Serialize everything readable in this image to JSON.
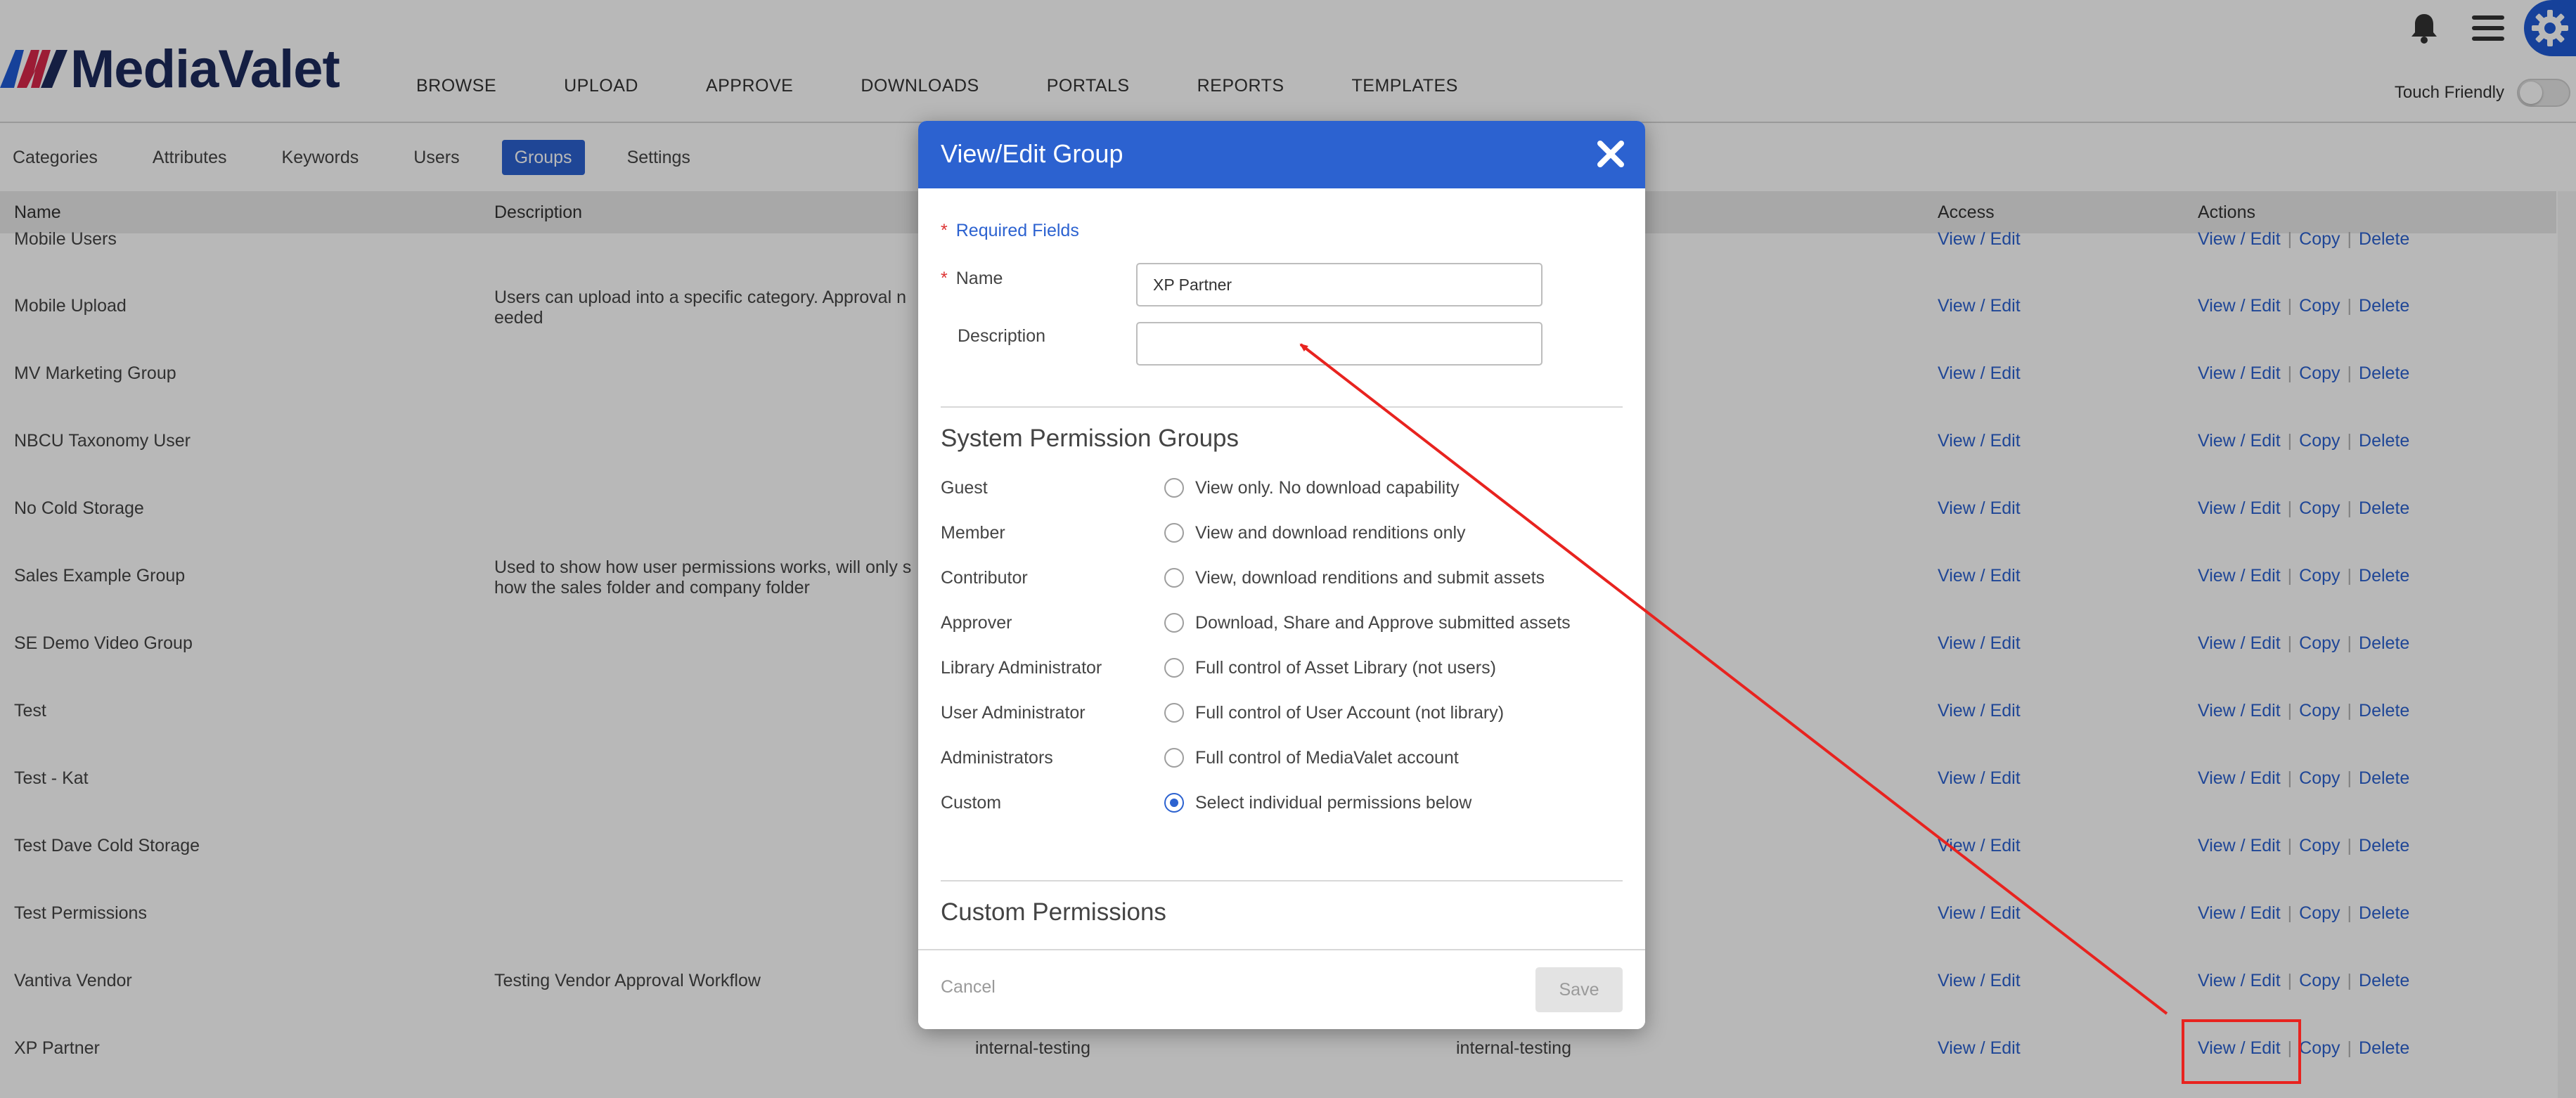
{
  "header": {
    "brand": "MediaValet",
    "nav": [
      "BROWSE",
      "UPLOAD",
      "APPROVE",
      "DOWNLOADS",
      "PORTALS",
      "REPORTS",
      "TEMPLATES"
    ],
    "touch_label": "Touch Friendly",
    "touch_enabled": false,
    "accent_color": "#1f5bd6"
  },
  "subtabs": {
    "items": [
      "Categories",
      "Attributes",
      "Keywords",
      "Users",
      "Groups",
      "Settings"
    ],
    "active": "Groups"
  },
  "table": {
    "headers": {
      "name": "Name",
      "description": "Description",
      "access": "Access",
      "actions": "Actions"
    },
    "action_labels": {
      "view_edit": "View / Edit",
      "copy": "Copy",
      "delete": "Delete"
    },
    "rows": [
      {
        "name": "Mobile Users",
        "description": "",
        "col3": "",
        "col4": ""
      },
      {
        "name": "Mobile Upload",
        "description": "Users can upload into a specific category. Approval n\needed",
        "col3": "",
        "col4": ""
      },
      {
        "name": "MV Marketing Group",
        "description": "",
        "col3": "",
        "col4": ""
      },
      {
        "name": "NBCU Taxonomy User",
        "description": "",
        "col3": "",
        "col4": ""
      },
      {
        "name": "No Cold Storage",
        "description": "",
        "col3": "",
        "col4": ""
      },
      {
        "name": "Sales Example Group",
        "description": "Used to show how user permissions works, will only s\nhow the sales folder and company folder",
        "col3": "",
        "col4": ""
      },
      {
        "name": "SE Demo Video Group",
        "description": "",
        "col3": "",
        "col4": ""
      },
      {
        "name": "Test",
        "description": "",
        "col3": "",
        "col4": ""
      },
      {
        "name": "Test - Kat",
        "description": "",
        "col3": "",
        "col4": ""
      },
      {
        "name": "Test Dave Cold Storage",
        "description": "",
        "col3": "",
        "col4": ""
      },
      {
        "name": "Test Permissions",
        "description": "",
        "col3": "",
        "col4": ""
      },
      {
        "name": "Vantiva Vendor",
        "description": "Testing Vendor Approval Workflow",
        "col3": "",
        "col4": ""
      },
      {
        "name": "XP Partner",
        "description": "",
        "col3": "internal-testing",
        "col4": "internal-testing"
      }
    ]
  },
  "modal": {
    "title": "View/Edit Group",
    "required_note": "Required Fields",
    "name_label": "Name",
    "name_value": "XP Partner",
    "description_label": "Description",
    "description_value": "",
    "system_section_title": "System Permission Groups",
    "permissions": [
      {
        "label": "Guest",
        "description": "View only. No download capability",
        "checked": false
      },
      {
        "label": "Member",
        "description": "View and download renditions only",
        "checked": false
      },
      {
        "label": "Contributor",
        "description": "View, download renditions and submit assets",
        "checked": false
      },
      {
        "label": "Approver",
        "description": "Download, Share and Approve submitted assets",
        "checked": false
      },
      {
        "label": "Library Administrator",
        "description": "Full control of Asset Library (not users)",
        "checked": false
      },
      {
        "label": "User Administrator",
        "description": "Full control of User Account (not library)",
        "checked": false
      },
      {
        "label": "Administrators",
        "description": "Full control of MediaValet account",
        "checked": false
      },
      {
        "label": "Custom",
        "description": "Select individual permissions below",
        "checked": true
      }
    ],
    "custom_section_title": "Custom Permissions",
    "cancel_label": "Cancel",
    "save_label": "Save"
  },
  "annotation_color": "#e8231f"
}
